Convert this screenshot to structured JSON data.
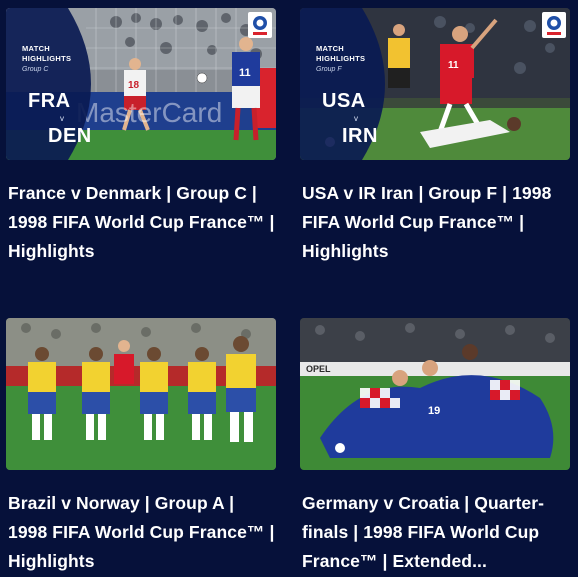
{
  "cards": [
    {
      "title": "France v Denmark | Group C | 1998 FIFA World Cup France™ | Highlights",
      "overlay": {
        "label_line1": "MATCH",
        "label_line2": "HIGHLIGHTS",
        "group": "Group C",
        "team1": "FRA",
        "vs": "v",
        "team2": "DEN"
      },
      "scene_texts": {
        "jersey1": "18",
        "jersey2": "11",
        "board": "MasterCard"
      }
    },
    {
      "title": "USA v IR Iran | Group F | 1998 FIFA World Cup France™ | Highlights",
      "overlay": {
        "label_line1": "MATCH",
        "label_line2": "HIGHLIGHTS",
        "group": "Group F",
        "team1": "USA",
        "vs": "v",
        "team2": "IRN"
      },
      "scene_texts": {
        "jersey1": "11"
      }
    },
    {
      "title": "Brazil v Norway | Group A | 1998 FIFA World Cup France™ | Highlights"
    },
    {
      "title": "Germany v Croatia | Quarter-finals | 1998 FIFA World Cup France™ | Extended...",
      "scene_texts": {
        "jersey1": "19",
        "board": "OPEL"
      }
    }
  ],
  "colors": {
    "background": "#06113a",
    "overlay": "#0a1a52",
    "pitch": "#3f8f3a"
  }
}
